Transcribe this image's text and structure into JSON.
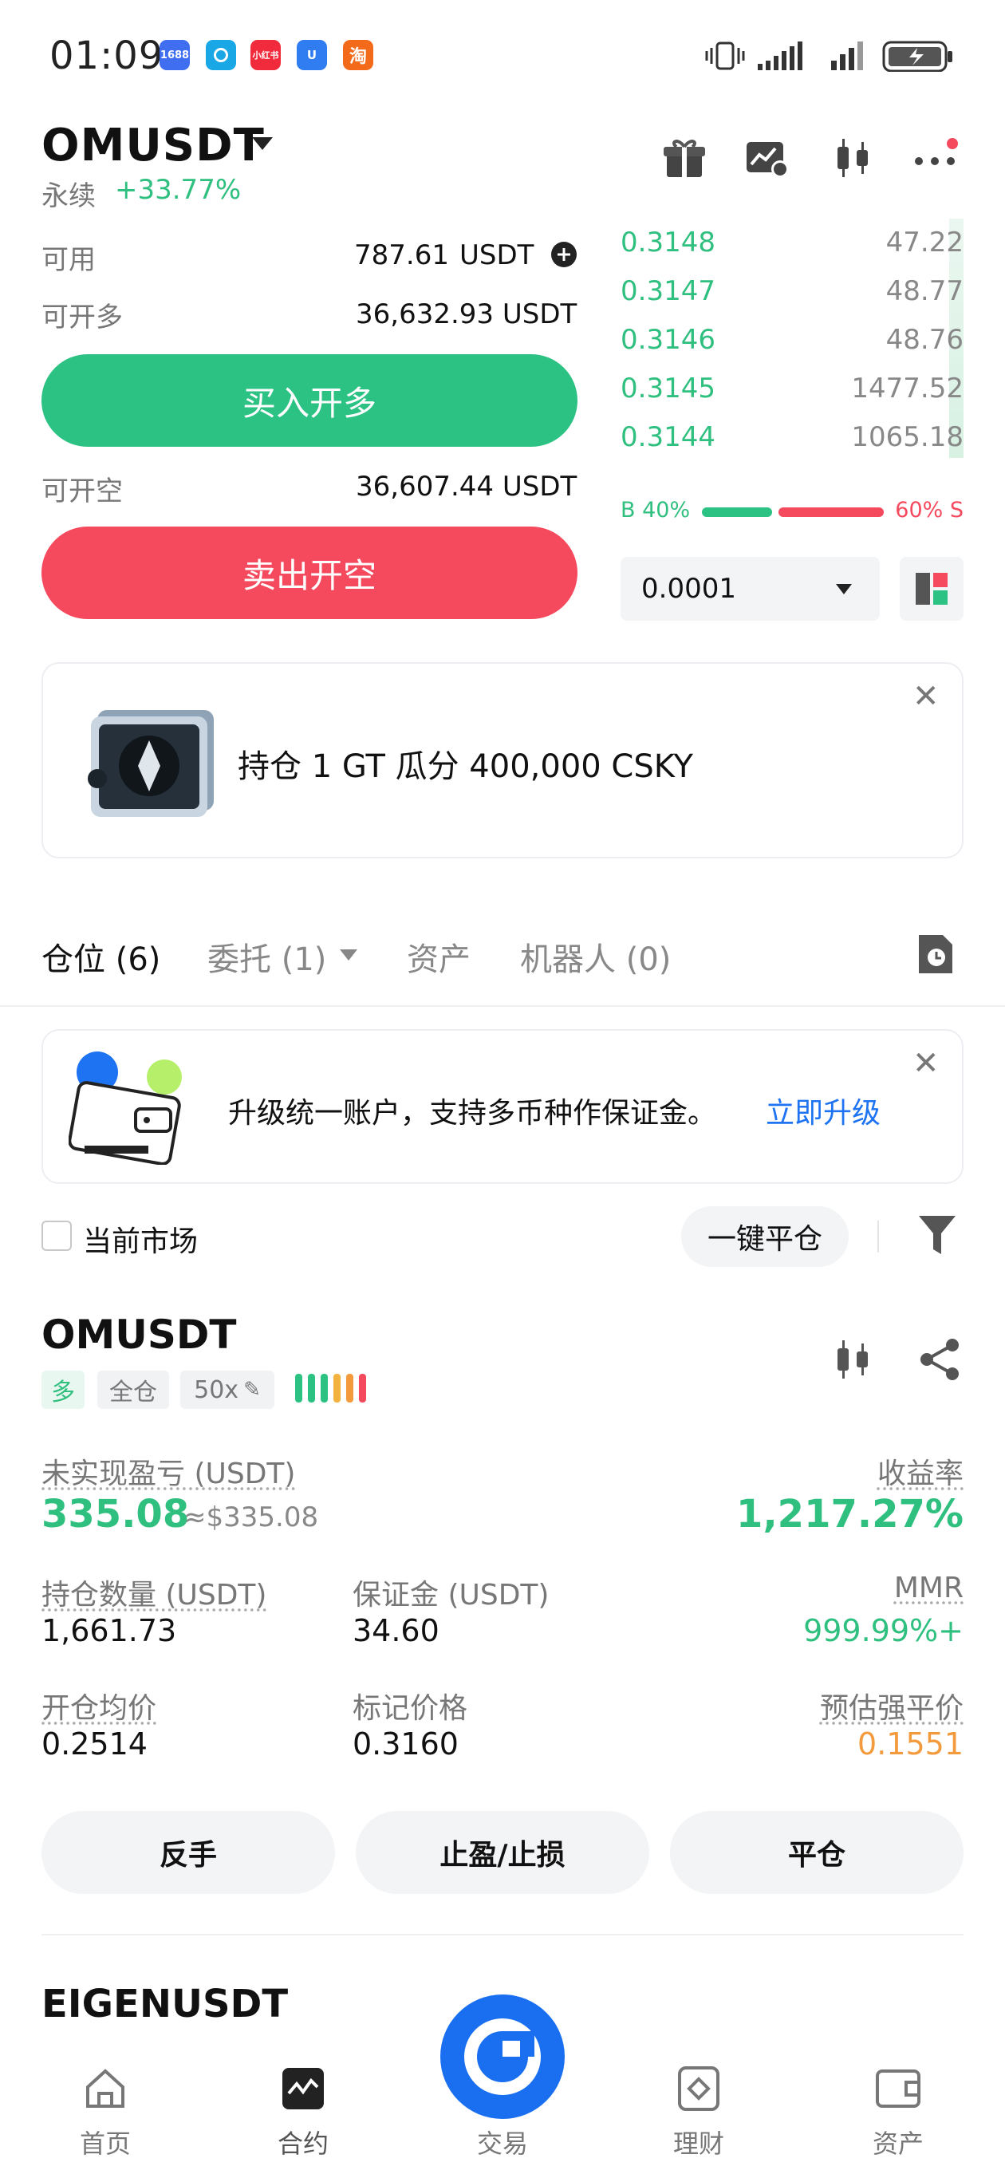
{
  "status_bar": {
    "time": "01:09",
    "apps": [
      {
        "name": "1688",
        "color": "#3f6ff0"
      },
      {
        "name": "",
        "color": "#1aa7e6"
      },
      {
        "name": "小红书",
        "color": "#f12b3c"
      },
      {
        "name": "",
        "color": "#2f7df0"
      },
      {
        "name": "淘",
        "color": "#f36a1b"
      }
    ]
  },
  "header": {
    "pair": "OMUSDT",
    "contract_type": "永续",
    "change": "+33.77%"
  },
  "trade_panel": {
    "available_label": "可用",
    "available_value": "787.61",
    "available_unit": "USDT",
    "open_long_label": "可开多",
    "open_long_value": "36,632.93 USDT",
    "buy_button": "买入开多",
    "open_short_label": "可开空",
    "open_short_value": "36,607.44 USDT",
    "sell_button": "卖出开空"
  },
  "order_book": {
    "rows": [
      {
        "price": "0.3148",
        "qty": "47.22"
      },
      {
        "price": "0.3147",
        "qty": "48.77"
      },
      {
        "price": "0.3146",
        "qty": "48.76"
      },
      {
        "price": "0.3145",
        "qty": "1477.52"
      },
      {
        "price": "0.3144",
        "qty": "1065.18"
      }
    ],
    "buy_ratio": "B 40%",
    "sell_ratio": "60% S",
    "buy_fraction": 0.4,
    "precision": "0.0001"
  },
  "promo": {
    "text": "持仓 1 GT 瓜分 400,000 CSKY"
  },
  "tabs": {
    "positions": "仓位 (6)",
    "orders": "委托 (1)",
    "assets": "资产",
    "bots": "机器人 (0)"
  },
  "upgrade_banner": {
    "text": "升级统一账户，支持多币种作保证金。",
    "link": "立即升级"
  },
  "filters": {
    "current_market": "当前市场",
    "close_all": "一键平仓"
  },
  "position": {
    "symbol": "OMUSDT",
    "side": "多",
    "margin_mode": "全仓",
    "leverage": "50x",
    "unrealized_label": "未实现盈亏 (USDT)",
    "unrealized_value": "335.08",
    "unrealized_usd": "≈$335.08",
    "roe_label": "收益率",
    "roe_value": "1,217.27%",
    "size_label": "持仓数量 (USDT)",
    "size_value": "1,661.73",
    "margin_label": "保证金 (USDT)",
    "margin_value": "34.60",
    "mmr_label": "MMR",
    "mmr_value": "999.99%+",
    "entry_label": "开仓均价",
    "entry_value": "0.2514",
    "mark_label": "标记价格",
    "mark_value": "0.3160",
    "liq_label": "预估强平价",
    "liq_value": "0.1551",
    "btn_reverse": "反手",
    "btn_tpsl": "止盈/止损",
    "btn_close": "平仓"
  },
  "next_position": {
    "symbol": "EIGENUSDT"
  },
  "bottom_nav": {
    "home": "首页",
    "futures": "合约",
    "trade": "交易",
    "earn": "理财",
    "assets": "资产"
  }
}
